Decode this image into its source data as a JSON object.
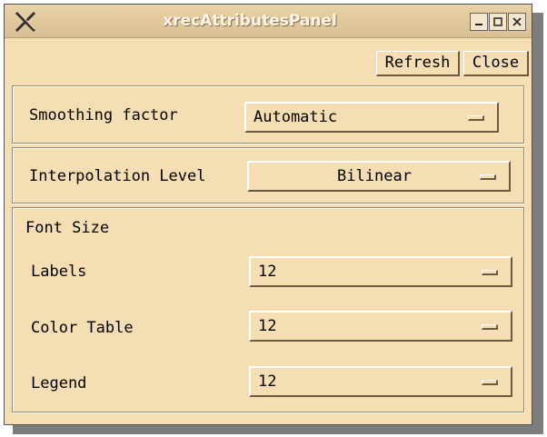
{
  "window": {
    "title": "xrecAttributesPanel",
    "icon": "x-logo-icon",
    "controls": [
      "minimize-icon",
      "maximize-icon",
      "close-icon"
    ]
  },
  "toolbar": {
    "refresh_label": "Refresh",
    "close_label": "Close"
  },
  "smoothing": {
    "label": "Smoothing factor",
    "value": "Automatic"
  },
  "interpolation": {
    "label": "Interpolation Level",
    "value": "Bilinear"
  },
  "font_size": {
    "heading": "Font Size",
    "rows": [
      {
        "label": "Labels",
        "value": "12"
      },
      {
        "label": "Color Table",
        "value": "12"
      },
      {
        "label": "Legend",
        "value": "12"
      }
    ]
  },
  "colors": {
    "background": "#f5deb3",
    "title_text": "#fff6e6"
  }
}
